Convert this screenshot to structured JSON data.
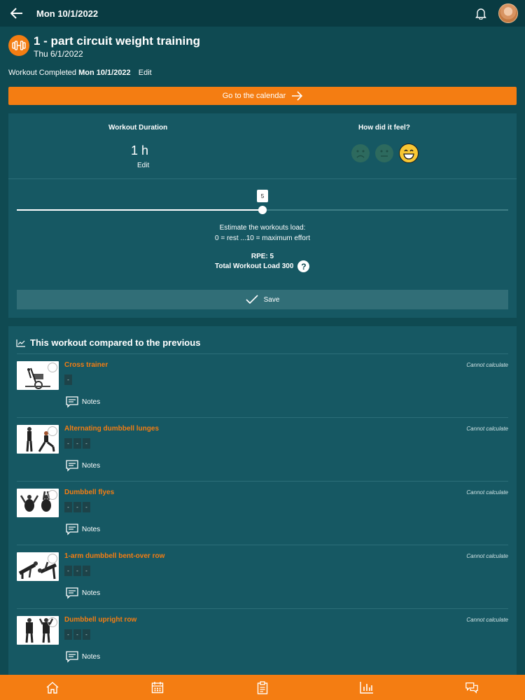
{
  "topbar": {
    "date": "Mon 10/1/2022"
  },
  "header": {
    "title": "1 - part circuit weight training",
    "subtitle": "Thu 6/1/2022"
  },
  "completed": {
    "label": "Workout Completed",
    "date": "Mon 10/1/2022",
    "edit": "Edit"
  },
  "calendar_button": {
    "label": "Go to the calendar"
  },
  "duration": {
    "label": "Workout Duration",
    "value": "1 h",
    "edit": "Edit"
  },
  "feel": {
    "label": "How did it feel?",
    "selected": "happy"
  },
  "slider": {
    "value": 5,
    "max": 10,
    "label": "5"
  },
  "estimate": {
    "line1": "Estimate the workouts load:",
    "line2": "0 = rest ...10 = maximum effort"
  },
  "rpe": "RPE: 5",
  "total_load": "Total Workout Load 300",
  "save_label": "Save",
  "compare": {
    "title": "This workout compared to the previous",
    "items": [
      {
        "name": "Cross trainer",
        "boxes": [
          "-"
        ],
        "notes": "Notes",
        "status": "Cannot calculate"
      },
      {
        "name": "Alternating dumbbell lunges",
        "boxes": [
          "-",
          "-",
          "-"
        ],
        "notes": "Notes",
        "status": "Cannot calculate"
      },
      {
        "name": "Dumbbell flyes",
        "boxes": [
          "-",
          "-",
          "-"
        ],
        "notes": "Notes",
        "status": "Cannot calculate"
      },
      {
        "name": "1-arm dumbbell bent-over row",
        "boxes": [
          "-",
          "-",
          "-"
        ],
        "notes": "Notes",
        "status": "Cannot calculate"
      },
      {
        "name": "Dumbbell upright row",
        "boxes": [
          "-",
          "-",
          "-"
        ],
        "notes": "Notes",
        "status": "Cannot calculate"
      }
    ]
  },
  "colors": {
    "accent": "#f47d12",
    "background": "#0f4a52",
    "card": "#165863"
  },
  "nav": [
    "home-icon",
    "calendar-icon",
    "clipboard-icon",
    "chart-icon",
    "chat-icon"
  ]
}
